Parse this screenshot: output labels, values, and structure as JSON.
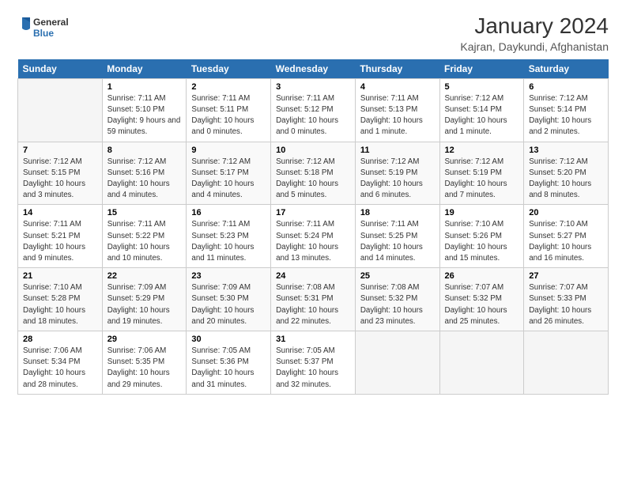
{
  "logo": {
    "general": "General",
    "blue": "Blue"
  },
  "title": "January 2024",
  "subtitle": "Kajran, Daykundi, Afghanistan",
  "calendar": {
    "headers": [
      "Sunday",
      "Monday",
      "Tuesday",
      "Wednesday",
      "Thursday",
      "Friday",
      "Saturday"
    ],
    "weeks": [
      [
        {
          "day": "",
          "sunrise": "",
          "sunset": "",
          "daylight": ""
        },
        {
          "day": "1",
          "sunrise": "Sunrise: 7:11 AM",
          "sunset": "Sunset: 5:10 PM",
          "daylight": "Daylight: 9 hours and 59 minutes."
        },
        {
          "day": "2",
          "sunrise": "Sunrise: 7:11 AM",
          "sunset": "Sunset: 5:11 PM",
          "daylight": "Daylight: 10 hours and 0 minutes."
        },
        {
          "day": "3",
          "sunrise": "Sunrise: 7:11 AM",
          "sunset": "Sunset: 5:12 PM",
          "daylight": "Daylight: 10 hours and 0 minutes."
        },
        {
          "day": "4",
          "sunrise": "Sunrise: 7:11 AM",
          "sunset": "Sunset: 5:13 PM",
          "daylight": "Daylight: 10 hours and 1 minute."
        },
        {
          "day": "5",
          "sunrise": "Sunrise: 7:12 AM",
          "sunset": "Sunset: 5:14 PM",
          "daylight": "Daylight: 10 hours and 1 minute."
        },
        {
          "day": "6",
          "sunrise": "Sunrise: 7:12 AM",
          "sunset": "Sunset: 5:14 PM",
          "daylight": "Daylight: 10 hours and 2 minutes."
        }
      ],
      [
        {
          "day": "7",
          "sunrise": "Sunrise: 7:12 AM",
          "sunset": "Sunset: 5:15 PM",
          "daylight": "Daylight: 10 hours and 3 minutes."
        },
        {
          "day": "8",
          "sunrise": "Sunrise: 7:12 AM",
          "sunset": "Sunset: 5:16 PM",
          "daylight": "Daylight: 10 hours and 4 minutes."
        },
        {
          "day": "9",
          "sunrise": "Sunrise: 7:12 AM",
          "sunset": "Sunset: 5:17 PM",
          "daylight": "Daylight: 10 hours and 4 minutes."
        },
        {
          "day": "10",
          "sunrise": "Sunrise: 7:12 AM",
          "sunset": "Sunset: 5:18 PM",
          "daylight": "Daylight: 10 hours and 5 minutes."
        },
        {
          "day": "11",
          "sunrise": "Sunrise: 7:12 AM",
          "sunset": "Sunset: 5:19 PM",
          "daylight": "Daylight: 10 hours and 6 minutes."
        },
        {
          "day": "12",
          "sunrise": "Sunrise: 7:12 AM",
          "sunset": "Sunset: 5:19 PM",
          "daylight": "Daylight: 10 hours and 7 minutes."
        },
        {
          "day": "13",
          "sunrise": "Sunrise: 7:12 AM",
          "sunset": "Sunset: 5:20 PM",
          "daylight": "Daylight: 10 hours and 8 minutes."
        }
      ],
      [
        {
          "day": "14",
          "sunrise": "Sunrise: 7:11 AM",
          "sunset": "Sunset: 5:21 PM",
          "daylight": "Daylight: 10 hours and 9 minutes."
        },
        {
          "day": "15",
          "sunrise": "Sunrise: 7:11 AM",
          "sunset": "Sunset: 5:22 PM",
          "daylight": "Daylight: 10 hours and 10 minutes."
        },
        {
          "day": "16",
          "sunrise": "Sunrise: 7:11 AM",
          "sunset": "Sunset: 5:23 PM",
          "daylight": "Daylight: 10 hours and 11 minutes."
        },
        {
          "day": "17",
          "sunrise": "Sunrise: 7:11 AM",
          "sunset": "Sunset: 5:24 PM",
          "daylight": "Daylight: 10 hours and 13 minutes."
        },
        {
          "day": "18",
          "sunrise": "Sunrise: 7:11 AM",
          "sunset": "Sunset: 5:25 PM",
          "daylight": "Daylight: 10 hours and 14 minutes."
        },
        {
          "day": "19",
          "sunrise": "Sunrise: 7:10 AM",
          "sunset": "Sunset: 5:26 PM",
          "daylight": "Daylight: 10 hours and 15 minutes."
        },
        {
          "day": "20",
          "sunrise": "Sunrise: 7:10 AM",
          "sunset": "Sunset: 5:27 PM",
          "daylight": "Daylight: 10 hours and 16 minutes."
        }
      ],
      [
        {
          "day": "21",
          "sunrise": "Sunrise: 7:10 AM",
          "sunset": "Sunset: 5:28 PM",
          "daylight": "Daylight: 10 hours and 18 minutes."
        },
        {
          "day": "22",
          "sunrise": "Sunrise: 7:09 AM",
          "sunset": "Sunset: 5:29 PM",
          "daylight": "Daylight: 10 hours and 19 minutes."
        },
        {
          "day": "23",
          "sunrise": "Sunrise: 7:09 AM",
          "sunset": "Sunset: 5:30 PM",
          "daylight": "Daylight: 10 hours and 20 minutes."
        },
        {
          "day": "24",
          "sunrise": "Sunrise: 7:08 AM",
          "sunset": "Sunset: 5:31 PM",
          "daylight": "Daylight: 10 hours and 22 minutes."
        },
        {
          "day": "25",
          "sunrise": "Sunrise: 7:08 AM",
          "sunset": "Sunset: 5:32 PM",
          "daylight": "Daylight: 10 hours and 23 minutes."
        },
        {
          "day": "26",
          "sunrise": "Sunrise: 7:07 AM",
          "sunset": "Sunset: 5:32 PM",
          "daylight": "Daylight: 10 hours and 25 minutes."
        },
        {
          "day": "27",
          "sunrise": "Sunrise: 7:07 AM",
          "sunset": "Sunset: 5:33 PM",
          "daylight": "Daylight: 10 hours and 26 minutes."
        }
      ],
      [
        {
          "day": "28",
          "sunrise": "Sunrise: 7:06 AM",
          "sunset": "Sunset: 5:34 PM",
          "daylight": "Daylight: 10 hours and 28 minutes."
        },
        {
          "day": "29",
          "sunrise": "Sunrise: 7:06 AM",
          "sunset": "Sunset: 5:35 PM",
          "daylight": "Daylight: 10 hours and 29 minutes."
        },
        {
          "day": "30",
          "sunrise": "Sunrise: 7:05 AM",
          "sunset": "Sunset: 5:36 PM",
          "daylight": "Daylight: 10 hours and 31 minutes."
        },
        {
          "day": "31",
          "sunrise": "Sunrise: 7:05 AM",
          "sunset": "Sunset: 5:37 PM",
          "daylight": "Daylight: 10 hours and 32 minutes."
        },
        {
          "day": "",
          "sunrise": "",
          "sunset": "",
          "daylight": ""
        },
        {
          "day": "",
          "sunrise": "",
          "sunset": "",
          "daylight": ""
        },
        {
          "day": "",
          "sunrise": "",
          "sunset": "",
          "daylight": ""
        }
      ]
    ]
  }
}
